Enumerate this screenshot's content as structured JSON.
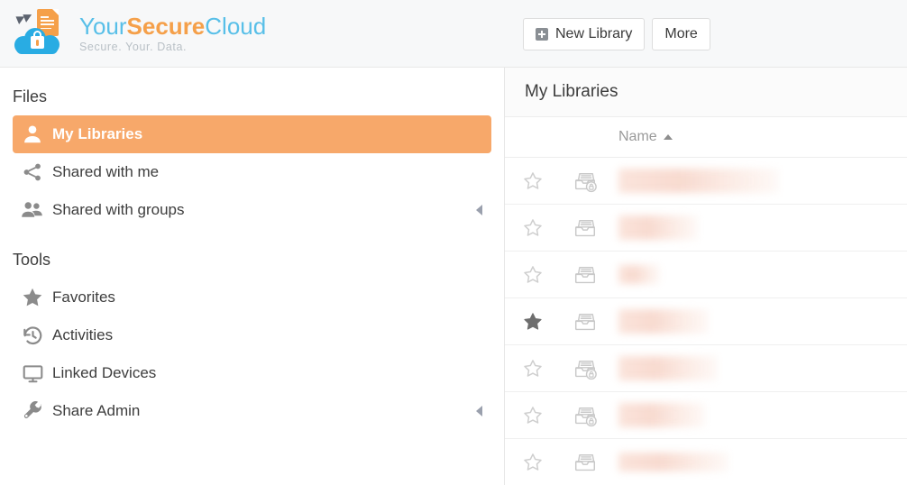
{
  "brand": {
    "name_part1": "Your",
    "name_part2": "Secure",
    "name_part3": "Cloud",
    "tagline": "Secure. Your. Data.",
    "logo_icon": "cloud-lock-document-logo",
    "colors": {
      "blue": "#58bfe8",
      "orange": "#f5a04a",
      "cloud_blue": "#29ace3"
    }
  },
  "toolbar": {
    "new_library_label": "New Library",
    "new_library_icon": "plus-square-icon",
    "more_label": "More"
  },
  "sidebar": {
    "sections": [
      {
        "heading": "Files",
        "items": [
          {
            "label": "My Libraries",
            "icon": "user-icon",
            "active": true,
            "caret": false
          },
          {
            "label": "Shared with me",
            "icon": "share-nodes-icon",
            "active": false,
            "caret": false
          },
          {
            "label": "Shared with groups",
            "icon": "users-group-icon",
            "active": false,
            "caret": true
          }
        ]
      },
      {
        "heading": "Tools",
        "items": [
          {
            "label": "Favorites",
            "icon": "star-icon",
            "active": false,
            "caret": false
          },
          {
            "label": "Activities",
            "icon": "history-icon",
            "active": false,
            "caret": false
          },
          {
            "label": "Linked Devices",
            "icon": "monitor-icon",
            "active": false,
            "caret": false
          },
          {
            "label": "Share Admin",
            "icon": "wrench-icon",
            "active": false,
            "caret": true
          }
        ]
      }
    ]
  },
  "main": {
    "title": "My Libraries",
    "table": {
      "columns": [
        {
          "key": "favorite",
          "label": "",
          "icon": "star-column-icon"
        },
        {
          "key": "type",
          "label": "",
          "icon": "library-column-icon"
        },
        {
          "key": "name",
          "label": "Name",
          "sort": "asc",
          "sort_icon": "caret-up-icon"
        }
      ],
      "rows": [
        {
          "favorite": false,
          "icon": "encrypted-library-icon",
          "name": "",
          "name_redacted": true,
          "redact_width": 178,
          "redact_lines": 2
        },
        {
          "favorite": false,
          "icon": "library-icon",
          "name": "",
          "name_redacted": true,
          "redact_width": 88,
          "redact_lines": 2
        },
        {
          "favorite": false,
          "icon": "library-icon",
          "name": "",
          "name_redacted": true,
          "redact_width": 46,
          "redact_lines": 1
        },
        {
          "favorite": true,
          "icon": "library-icon",
          "name": "",
          "name_redacted": true,
          "redact_width": 100,
          "redact_lines": 2
        },
        {
          "favorite": false,
          "icon": "encrypted-library-icon",
          "name": "",
          "name_redacted": true,
          "redact_width": 110,
          "redact_lines": 2
        },
        {
          "favorite": false,
          "icon": "encrypted-library-icon",
          "name": "",
          "name_redacted": true,
          "redact_width": 96,
          "redact_lines": 2
        },
        {
          "favorite": false,
          "icon": "library-icon",
          "name": "",
          "name_redacted": true,
          "redact_width": 122,
          "redact_lines": 1
        }
      ]
    }
  },
  "theme": {
    "accent_orange": "#f7a86a",
    "topbar_bg": "#f7f8f9",
    "panel_bg": "#ffffff",
    "border": "#e6e6e6",
    "text": "#3d3d3d",
    "muted_text": "#9a9a9a"
  }
}
